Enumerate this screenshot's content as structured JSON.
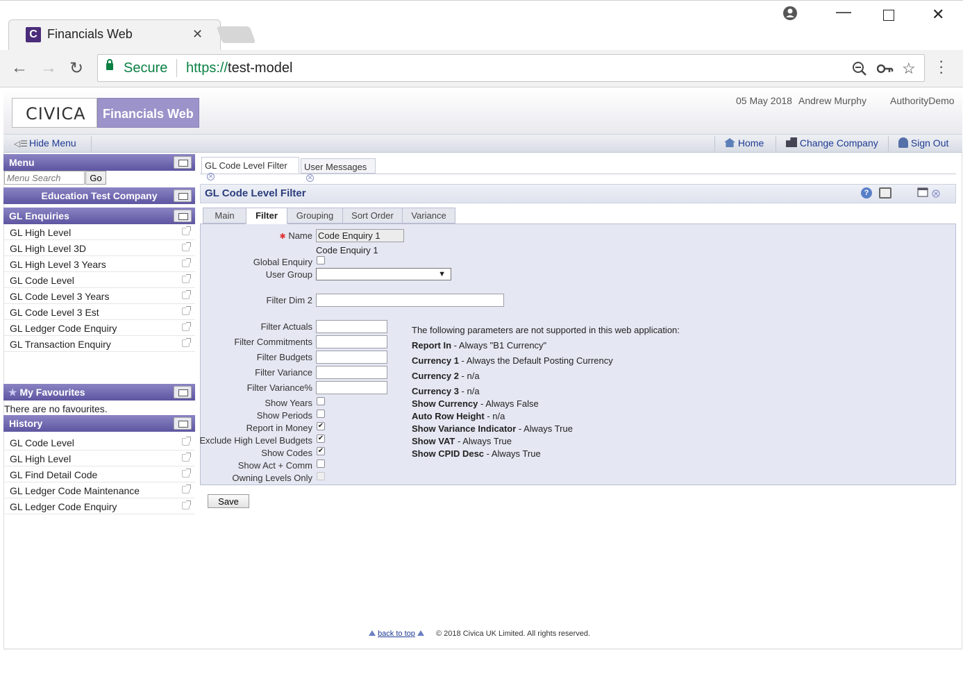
{
  "browser": {
    "tab_title": "Financials Web",
    "tab_favicon_letter": "C",
    "secure_label": "Secure",
    "url_scheme": "https://",
    "url_host": "test-model"
  },
  "header": {
    "logo_text": "CIVICA",
    "product_name": "Financials Web",
    "date": "05 May 2018",
    "user": "Andrew Murphy",
    "authority": "AuthorityDemo"
  },
  "menubar": {
    "hide_menu": "Hide Menu",
    "home": "Home",
    "change_company": "Change Company",
    "sign_out": "Sign Out"
  },
  "sidebar": {
    "menu_title": "Menu",
    "search_placeholder": "Menu Search",
    "go_label": "Go",
    "company": "Education Test Company",
    "section_title": "GL Enquiries",
    "items": [
      "GL High Level",
      "GL High Level 3D",
      "GL High Level 3 Years",
      "GL Code Level",
      "GL Code Level 3 Years",
      "GL Code Level 3 Est",
      "GL Ledger Code Enquiry",
      "GL Transaction Enquiry"
    ],
    "favourites_title": "My Favourites",
    "favourites_empty": "There are no favourites.",
    "history_title": "History",
    "history": [
      "GL Code Level",
      "GL High Level",
      "GL Find Detail Code",
      "GL Ledger Code Maintenance",
      "GL Ledger Code Enquiry"
    ]
  },
  "content": {
    "tabs": [
      "GL Code Level Filter",
      "User Messages"
    ],
    "panel_title": "GL Code Level Filter",
    "subtabs": [
      "Main",
      "Filter",
      "Grouping",
      "Sort Order",
      "Variance"
    ],
    "active_subtab": "Filter",
    "form": {
      "name_label": "Name",
      "name_value": "Code Enquiry 1",
      "name_display": "Code Enquiry 1",
      "global_enquiry_label": "Global Enquiry",
      "user_group_label": "User Group",
      "user_group_value": "",
      "filter_dim2_label": "Filter Dim 2",
      "filter_actuals_label": "Filter Actuals",
      "filter_commitments_label": "Filter Commitments",
      "filter_budgets_label": "Filter Budgets",
      "filter_variance_label": "Filter Variance",
      "filter_variance_pct_label": "Filter Variance%",
      "checkboxes": [
        {
          "label": "Show Years",
          "checked": false
        },
        {
          "label": "Show Periods",
          "checked": false
        },
        {
          "label": "Report in Money",
          "checked": true
        },
        {
          "label": "Exclude High Level Budgets",
          "checked": true
        },
        {
          "label": "Show Codes",
          "checked": true
        },
        {
          "label": "Show Act + Comm",
          "checked": false
        },
        {
          "label": "Owning Levels Only",
          "checked": false
        }
      ]
    },
    "notes": {
      "intro": "The following parameters are not supported in this web application:",
      "items": [
        {
          "key": "Report In",
          "value": " - Always \"B1 Currency\""
        },
        {
          "key": "Currency 1",
          "value": " - Always the Default Posting Currency"
        },
        {
          "key": "Currency 2",
          "value": " - n/a"
        },
        {
          "key": "Currency 3",
          "value": " - n/a"
        },
        {
          "key": "Show Currency",
          "value": " - Always False"
        },
        {
          "key": "Auto Row Height",
          "value": " - n/a"
        },
        {
          "key": "Show Variance Indicator",
          "value": " - Always True"
        },
        {
          "key": "Show VAT",
          "value": " - Always True"
        },
        {
          "key": "Show CPID Desc",
          "value": " - Always True"
        }
      ]
    },
    "save_label": "Save"
  },
  "footer": {
    "back_to_top": "back to top",
    "copyright": "© 2018 Civica UK Limited. All rights reserved."
  }
}
